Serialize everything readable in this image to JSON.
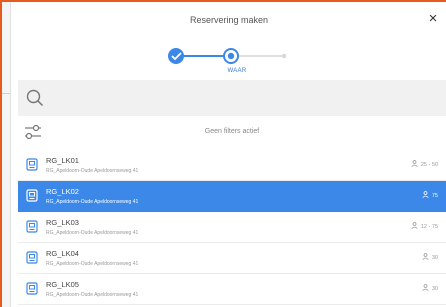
{
  "dialog": {
    "title": "Reservering maken",
    "close_label": "×"
  },
  "stepper": {
    "active_step_label": "WAAR",
    "steps": [
      "done",
      "active",
      "upcoming"
    ]
  },
  "search": {
    "placeholder": ""
  },
  "filters": {
    "status_text": "Geen filters actief"
  },
  "locations": [
    {
      "name": "RG_LK01",
      "address": "RG_Apeldoorn-Oude Apeldoornseweg 41",
      "capacity": "25 - 50",
      "selected": false
    },
    {
      "name": "RG_LK02",
      "address": "RG_Apeldoorn-Oude Apeldoornseweg 41",
      "capacity": "75",
      "selected": true
    },
    {
      "name": "RG_LK03",
      "address": "RG_Apeldoorn-Oude Apeldoornseweg 41",
      "capacity": "12 - 75",
      "selected": false
    },
    {
      "name": "RG_LK04",
      "address": "RG_Apeldoorn-Oude Apeldoornseweg 41",
      "capacity": "30",
      "selected": false
    },
    {
      "name": "RG_LK05",
      "address": "RG_Apeldoorn-Oude Apeldoornseweg 41",
      "capacity": "30",
      "selected": false
    }
  ],
  "colors": {
    "accent": "#3b88e8",
    "frame": "#e8591f"
  },
  "icons": {
    "close": "close-icon",
    "search": "search-icon",
    "filter": "filter-sliders-icon",
    "room": "room-badge-icon",
    "capacity": "person-icon",
    "step_done": "checkmark-icon"
  }
}
